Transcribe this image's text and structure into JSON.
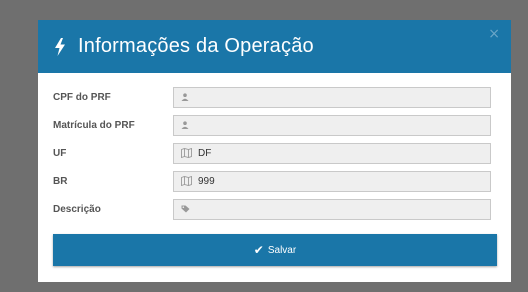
{
  "modal": {
    "title": "Informações da Operação",
    "close_label": "×"
  },
  "fields": [
    {
      "label": "CPF do PRF",
      "value": "",
      "icon": "user-icon"
    },
    {
      "label": "Matrícula do PRF",
      "value": "",
      "icon": "user-icon"
    },
    {
      "label": "UF",
      "value": "DF",
      "icon": "map-icon"
    },
    {
      "label": "BR",
      "value": "999",
      "icon": "map-icon"
    },
    {
      "label": "Descrição",
      "value": "",
      "icon": "tag-icon"
    }
  ],
  "save_button": {
    "label": "Salvar",
    "icon": "check-icon"
  },
  "colors": {
    "primary": "#1a76a8",
    "overlay": "#6f6f6f",
    "field_bg": "#efefef"
  }
}
